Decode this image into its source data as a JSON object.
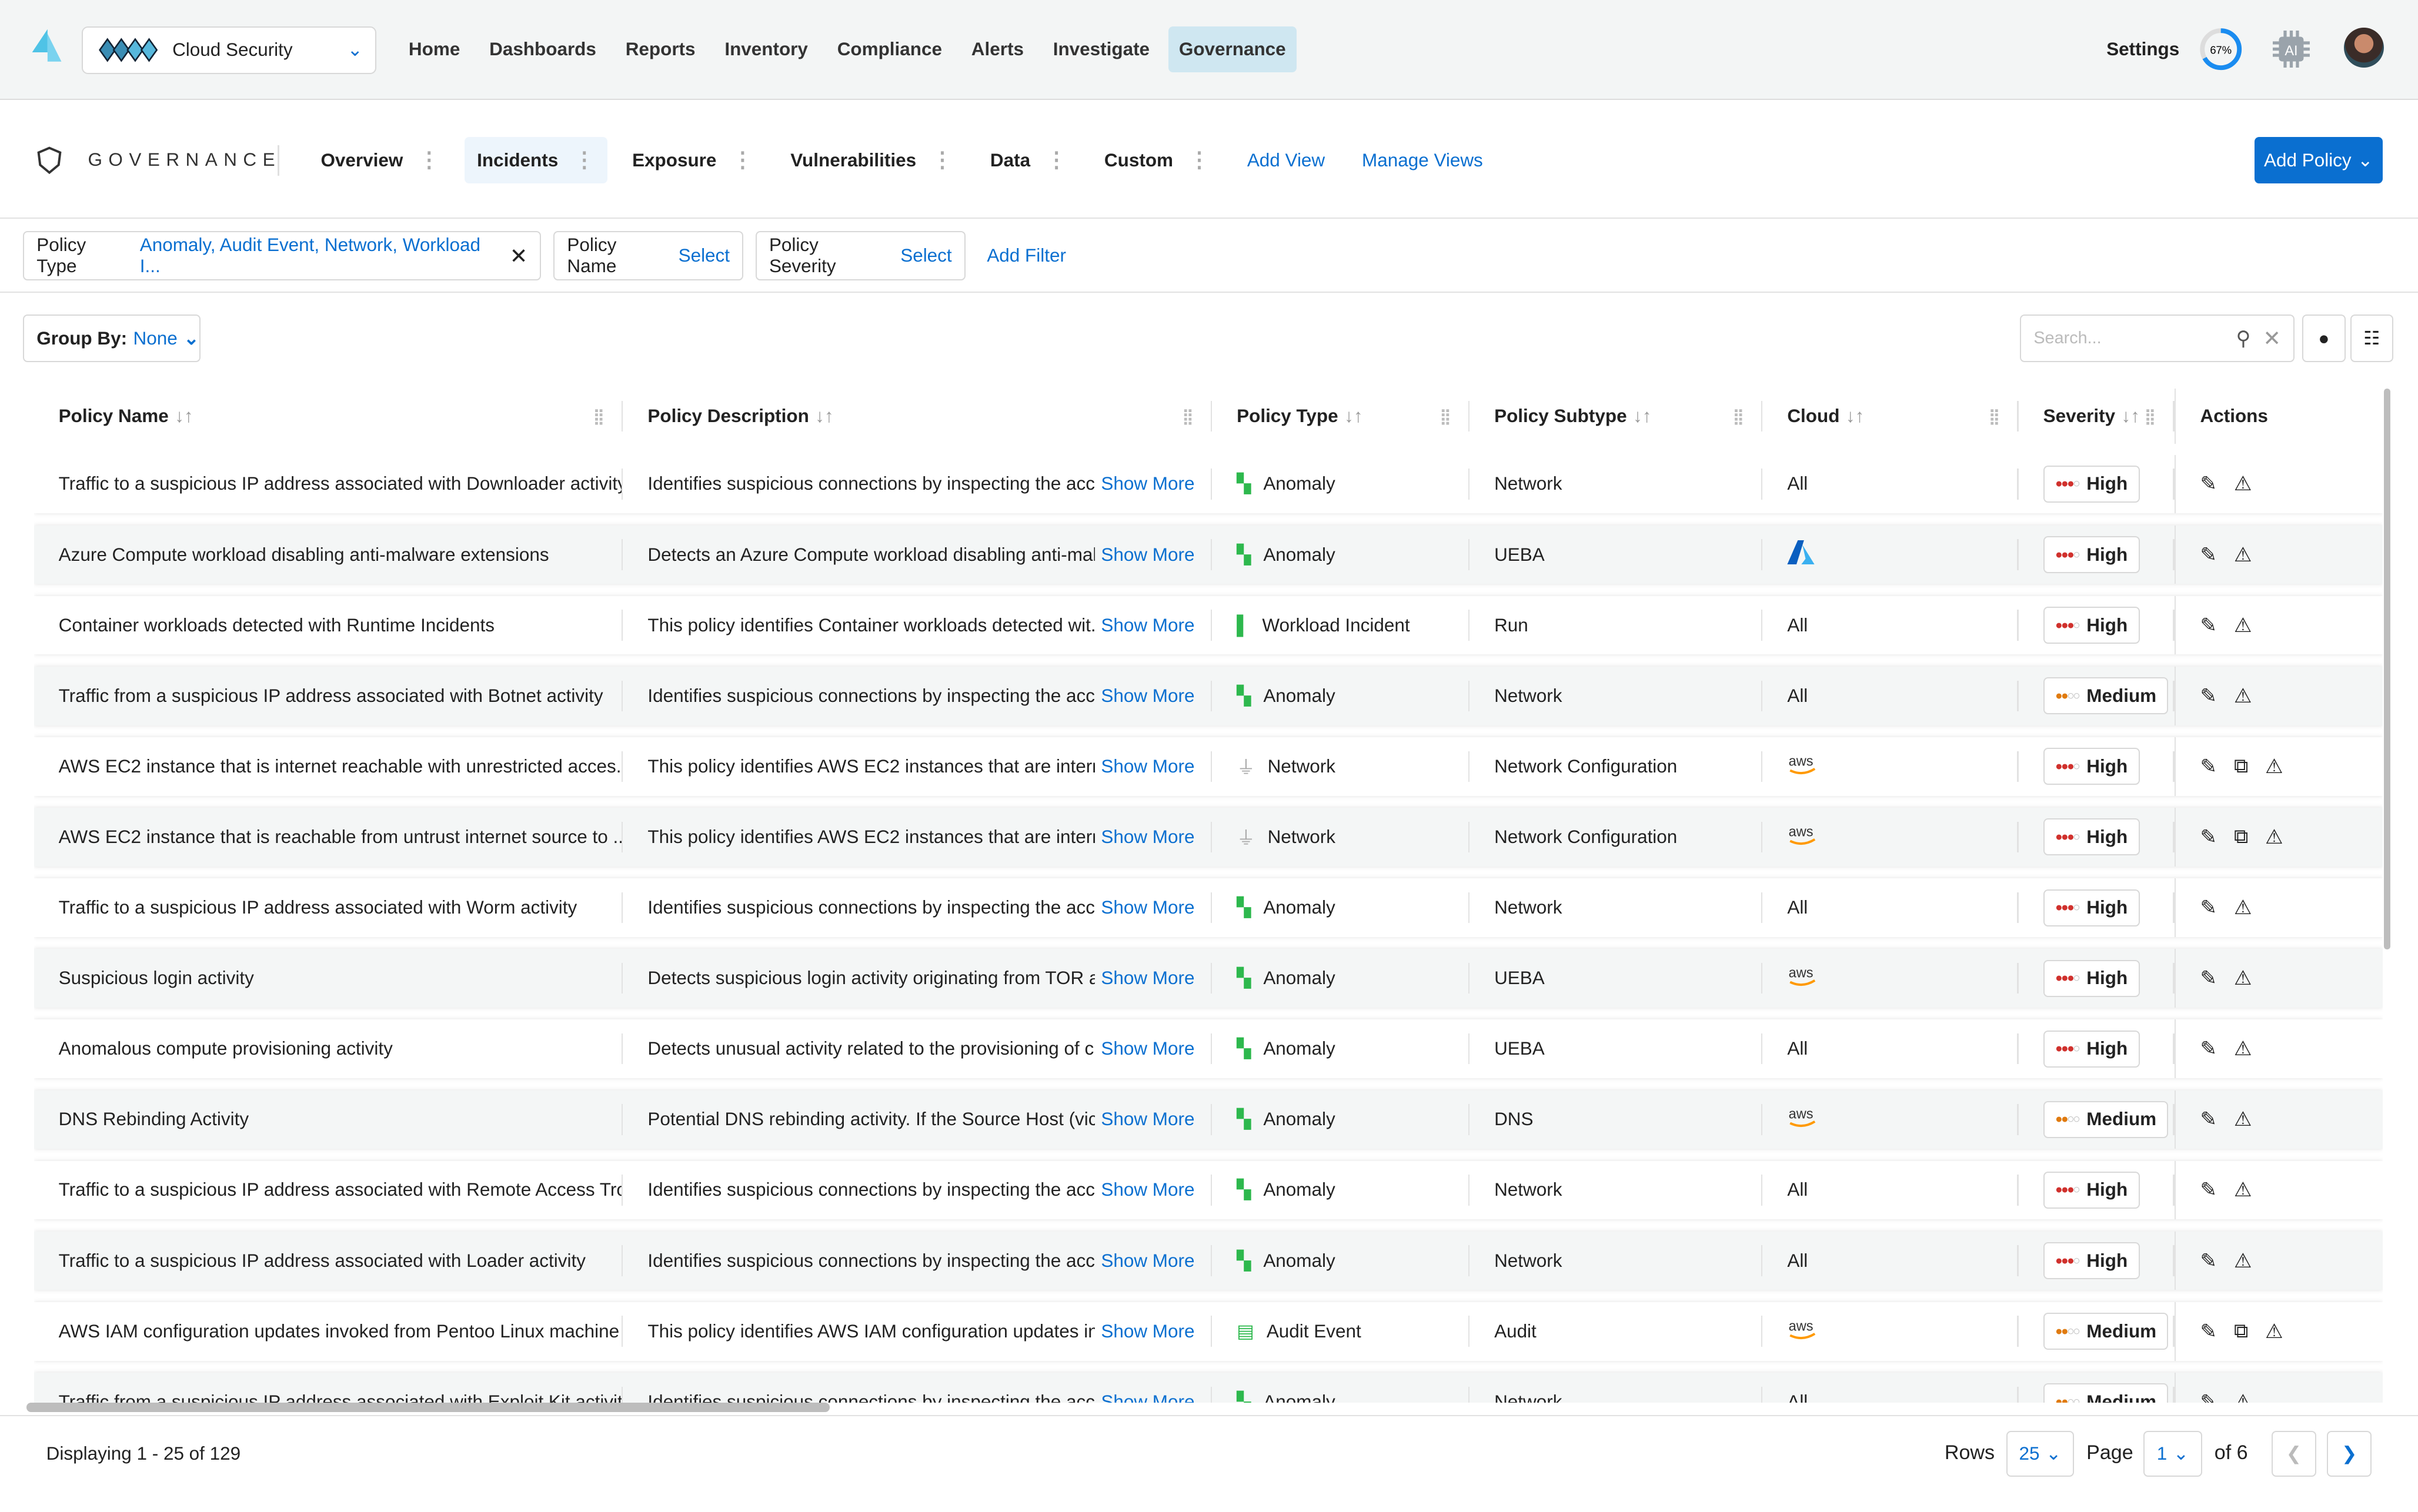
{
  "header": {
    "product": "Cloud Security",
    "nav": [
      "Home",
      "Dashboards",
      "Reports",
      "Inventory",
      "Compliance",
      "Alerts",
      "Investigate",
      "Governance"
    ],
    "active_nav": "Governance",
    "settings": "Settings",
    "progress_label": "67%",
    "progress": 0.67,
    "ai_label": "AI"
  },
  "governance": {
    "title": "GOVERNANCE",
    "tabs": [
      "Overview",
      "Incidents",
      "Exposure",
      "Vulnerabilities",
      "Data",
      "Custom"
    ],
    "active_tab": "Incidents",
    "add_view": "Add View",
    "manage_views": "Manage Views",
    "add_policy": "Add Policy"
  },
  "filters": {
    "policy_type_label": "Policy Type",
    "policy_type_value": "Anomaly, Audit Event, Network, Workload I...",
    "policy_name_label": "Policy Name",
    "policy_name_value": "Select",
    "policy_severity_label": "Policy Severity",
    "policy_severity_value": "Select",
    "add_filter": "Add Filter"
  },
  "toolbar": {
    "group_by_label": "Group By:",
    "group_by_value": "None",
    "search_placeholder": "Search..."
  },
  "table": {
    "columns": [
      "Policy Name",
      "Policy Description",
      "Policy Type",
      "Policy Subtype",
      "Cloud",
      "Severity",
      "Actions"
    ],
    "show_more": "Show More",
    "rows": [
      {
        "name": "Traffic to a suspicious IP address associated with Downloader activity",
        "desc": "Identifies suspicious connections by inspecting the acce...",
        "type": "Anomaly",
        "subtype": "Network",
        "cloud": "All",
        "severity": "High",
        "extra_action": false
      },
      {
        "name": "Azure Compute workload disabling anti-malware extensions",
        "desc": "Detects an Azure Compute workload disabling anti-mal...",
        "type": "Anomaly",
        "subtype": "UEBA",
        "cloud": "azure",
        "severity": "High",
        "extra_action": false
      },
      {
        "name": "Container workloads detected with Runtime Incidents",
        "desc": "This policy identifies Container workloads detected wit...",
        "type": "Workload Incident",
        "subtype": "Run",
        "cloud": "All",
        "severity": "High",
        "extra_action": false
      },
      {
        "name": "Traffic from a suspicious IP address associated with Botnet activity",
        "desc": "Identifies suspicious connections by inspecting the acce...",
        "type": "Anomaly",
        "subtype": "Network",
        "cloud": "All",
        "severity": "Medium",
        "extra_action": false
      },
      {
        "name": "AWS EC2 instance that is internet reachable with unrestricted acces...",
        "desc": "This policy identifies AWS EC2 instances that are intern...",
        "type": "Network",
        "subtype": "Network Configuration",
        "cloud": "aws",
        "severity": "High",
        "extra_action": true
      },
      {
        "name": "AWS EC2 instance that is reachable from untrust internet source to ...",
        "desc": "This policy identifies AWS EC2 instances that are intern...",
        "type": "Network",
        "subtype": "Network Configuration",
        "cloud": "aws",
        "severity": "High",
        "extra_action": true
      },
      {
        "name": "Traffic to a suspicious IP address associated with Worm activity",
        "desc": "Identifies suspicious connections by inspecting the acce...",
        "type": "Anomaly",
        "subtype": "Network",
        "cloud": "All",
        "severity": "High",
        "extra_action": false
      },
      {
        "name": "Suspicious login activity",
        "desc": "Detects suspicious login activity originating from TOR a...",
        "type": "Anomaly",
        "subtype": "UEBA",
        "cloud": "aws",
        "severity": "High",
        "extra_action": false
      },
      {
        "name": "Anomalous compute provisioning activity",
        "desc": "Detects unusual activity related to the provisioning of c...",
        "type": "Anomaly",
        "subtype": "UEBA",
        "cloud": "All",
        "severity": "High",
        "extra_action": false
      },
      {
        "name": "DNS Rebinding Activity",
        "desc": "Potential DNS rebinding activity. If the Source Host (vic...",
        "type": "Anomaly",
        "subtype": "DNS",
        "cloud": "aws",
        "severity": "Medium",
        "extra_action": false
      },
      {
        "name": "Traffic to a suspicious IP address associated with Remote Access Troj...",
        "desc": "Identifies suspicious connections by inspecting the acce...",
        "type": "Anomaly",
        "subtype": "Network",
        "cloud": "All",
        "severity": "High",
        "extra_action": false
      },
      {
        "name": "Traffic to a suspicious IP address associated with Loader activity",
        "desc": "Identifies suspicious connections by inspecting the acce...",
        "type": "Anomaly",
        "subtype": "Network",
        "cloud": "All",
        "severity": "High",
        "extra_action": false
      },
      {
        "name": "AWS IAM configuration updates invoked from Pentoo Linux machine",
        "desc": "This policy identifies AWS IAM configuration updates in...",
        "type": "Audit Event",
        "subtype": "Audit",
        "cloud": "aws",
        "severity": "Medium",
        "extra_action": true
      },
      {
        "name": "Traffic from a suspicious IP address associated with Exploit Kit activity",
        "desc": "Identifies suspicious connections by inspecting the acce...",
        "type": "Anomaly",
        "subtype": "Network",
        "cloud": "All",
        "severity": "Medium",
        "extra_action": false
      }
    ]
  },
  "footer": {
    "displaying": "Displaying 1 - 25 of 129",
    "rows_label": "Rows",
    "rows_value": "25",
    "page_label": "Page",
    "page_value": "1",
    "of_pages": "of 6"
  },
  "colors": {
    "accent": "#0a6fd0",
    "high": "#d0312d",
    "medium": "#e07b10",
    "anomaly": "#2db84d",
    "nav_active": "#cfe7f1"
  }
}
